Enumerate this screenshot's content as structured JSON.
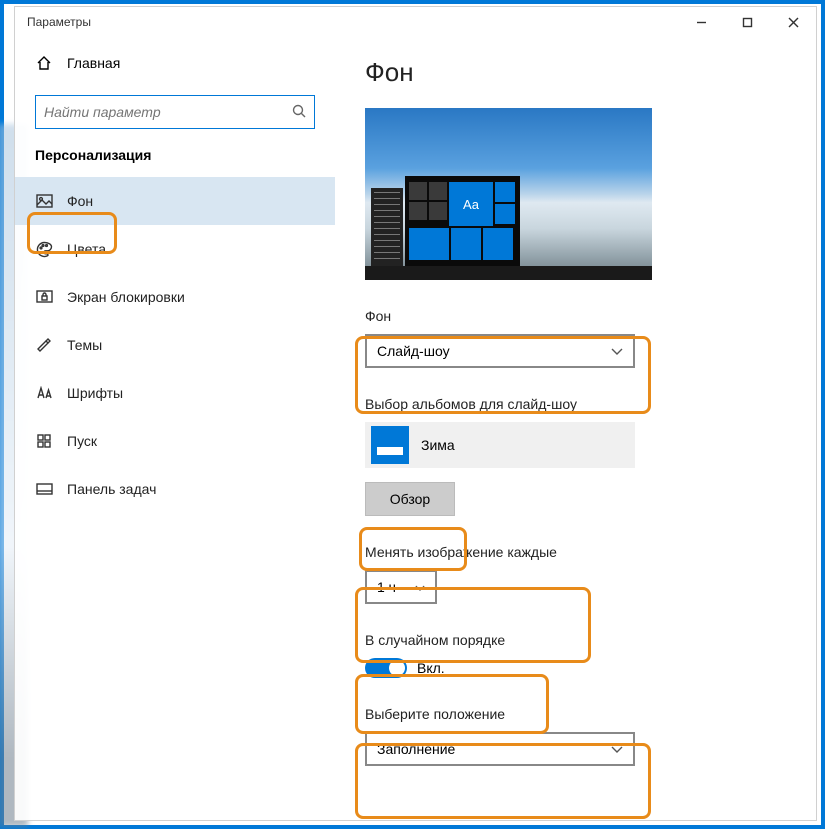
{
  "window": {
    "title": "Параметры"
  },
  "sidebar": {
    "home": "Главная",
    "search_placeholder": "Найти параметр",
    "category": "Персонализация",
    "items": [
      {
        "label": "Фон"
      },
      {
        "label": "Цвета"
      },
      {
        "label": "Экран блокировки"
      },
      {
        "label": "Темы"
      },
      {
        "label": "Шрифты"
      },
      {
        "label": "Пуск"
      },
      {
        "label": "Панель задач"
      }
    ]
  },
  "main": {
    "title": "Фон",
    "preview_sample": "Aa",
    "bg_label": "Фон",
    "bg_value": "Слайд-шоу",
    "album_label": "Выбор альбомов для слайд-шоу",
    "album_name": "Зима",
    "browse": "Обзор",
    "interval_label": "Менять изображение каждые",
    "interval_value": "1 ч",
    "shuffle_label": "В случайном порядке",
    "shuffle_state": "Вкл.",
    "fit_label": "Выберите положение",
    "fit_value": "Заполнение"
  }
}
